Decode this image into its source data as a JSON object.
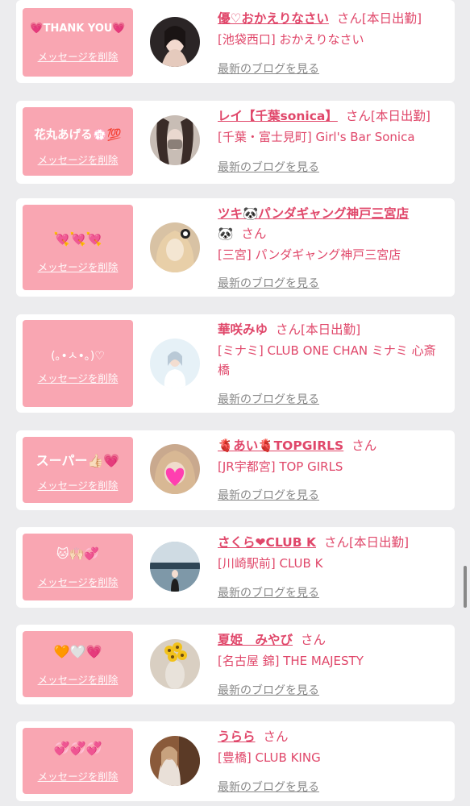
{
  "delete_label": "メッセージを削除",
  "blog_label": "最新のブログを見る",
  "cards": [
    {
      "message": "💗THANK YOU💗",
      "name": "優♡おかえりなさい",
      "suffix": "さん[本日出勤]",
      "shop": "[池袋西口] おかえりなさい",
      "avatar_color": "#2b2526",
      "avatar_accent": "#f2d9cf"
    },
    {
      "message": "花丸あげる💮💯",
      "name": "レイ【千葉sonica】",
      "suffix": "さん[本日出勤]",
      "shop": "[千葉・富士見町] Girl's Bar Sonica",
      "avatar_color": "#c8bdb5",
      "avatar_accent": "#3a2c28"
    },
    {
      "message": "💘💘💘",
      "name": "ツキ🐼パンダギャング神戸三宮店",
      "name2": "🐼",
      "suffix": "さん",
      "shop": "[三宮] パンダギャング神戸三宮店",
      "avatar_color": "#e8cfa8",
      "avatar_accent": "#f4e6d2"
    },
    {
      "message": "(｡•ㅅ•｡)♡",
      "name": "華咲みゆ",
      "suffix": "さん[本日出勤]",
      "shop": "[ミナミ] CLUB ONE CHAN ミナミ 心斎橋",
      "avatar_color": "#e6f1f7",
      "avatar_accent": "#b9c9d6"
    },
    {
      "message": "スーパー👍🏻💗",
      "name": "🫀あい🫀TOPGIRLS",
      "suffix": "さん",
      "shop": "[JR宇都宮] TOP GIRLS",
      "avatar_color": "#c9a98e",
      "avatar_accent": "#ff3fb0"
    },
    {
      "message": "🐱🙌🏻💞",
      "name": "さくら❤CLUB K",
      "suffix": "さん[本日出勤]",
      "shop": "[川崎駅前] CLUB K",
      "avatar_color": "#9fb7c6",
      "avatar_accent": "#2f4656"
    },
    {
      "message": "🧡🤍💗",
      "name": "夏姫　みやび",
      "suffix": "さん",
      "shop": "[名古屋 錦] THE MAJESTY",
      "avatar_color": "#d9cfc2",
      "avatar_accent": "#f2c21b"
    },
    {
      "message": "💞💞💞",
      "name": "うらら",
      "suffix": "さん",
      "shop": "[豊橋] CLUB KING",
      "avatar_color": "#8a5a3a",
      "avatar_accent": "#d8b49a"
    }
  ]
}
